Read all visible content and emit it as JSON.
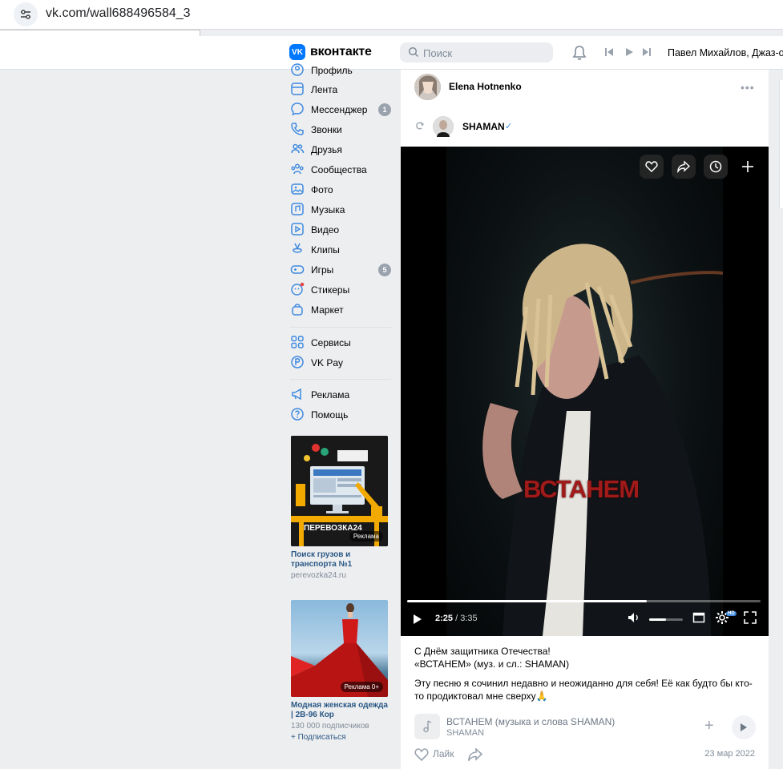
{
  "browser": {
    "url": "vk.com/wall688496584_3"
  },
  "header": {
    "logo_text": "вконтакте",
    "logo_mark": "VK",
    "search_placeholder": "Поиск",
    "user_name": "Павел Михайлов, Джаз-ор"
  },
  "sidebar": {
    "items": [
      {
        "label": "Профиль",
        "icon": "profile-icon"
      },
      {
        "label": "Лента",
        "icon": "news-icon"
      },
      {
        "label": "Мессенджер",
        "icon": "messenger-icon",
        "badge": "1"
      },
      {
        "label": "Звонки",
        "icon": "phone-icon"
      },
      {
        "label": "Друзья",
        "icon": "friends-icon"
      },
      {
        "label": "Сообщества",
        "icon": "communities-icon"
      },
      {
        "label": "Фото",
        "icon": "photo-icon"
      },
      {
        "label": "Музыка",
        "icon": "music-icon"
      },
      {
        "label": "Видео",
        "icon": "video-icon"
      },
      {
        "label": "Клипы",
        "icon": "clips-icon"
      },
      {
        "label": "Игры",
        "icon": "games-icon",
        "badge": "5"
      },
      {
        "label": "Стикеры",
        "icon": "stickers-icon"
      },
      {
        "label": "Маркет",
        "icon": "market-icon"
      },
      {
        "label": "Сервисы",
        "icon": "services-icon"
      },
      {
        "label": "VK Pay",
        "icon": "vkpay-icon"
      },
      {
        "label": "Реклама",
        "icon": "ads-icon"
      },
      {
        "label": "Помощь",
        "icon": "help-icon"
      }
    ],
    "ads": [
      {
        "title": "Поиск грузов и транспорта №1",
        "domain": "perevozka24.ru",
        "tag": "Реклама",
        "brand": "ПЕРЕВОЗКА24"
      },
      {
        "title": "Модная женская одежда | 2В-96 Кор",
        "subtitle": "130 000 подписчиков",
        "link": "+ Подписаться",
        "tag": "Реклама 0+"
      }
    ]
  },
  "post": {
    "author": "Elena Hotnenko",
    "source": "SHAMAN",
    "verified_mark": "✓",
    "video": {
      "overlay_title": "ВСТАНЕМ",
      "current_time": "2:25",
      "duration": "3:35",
      "progress": 0.677,
      "volume": 0.5,
      "quality_badge": "HD"
    },
    "text_lines": [
      "С Днём защитника Отечества!",
      "«ВСТАНЕМ» (муз. и сл.: SHAMAN)",
      "Эту песню я сочинил недавно и неожиданно для себя! Её как будто бы кто-",
      "то продиктовал мне сверху🙏"
    ],
    "audio": {
      "title": "ВСТАНЕМ (музыка и слова SHAMAN)",
      "artist": "SHAMAN"
    },
    "like_label": "Лайк",
    "date": "23 мар 2022"
  }
}
